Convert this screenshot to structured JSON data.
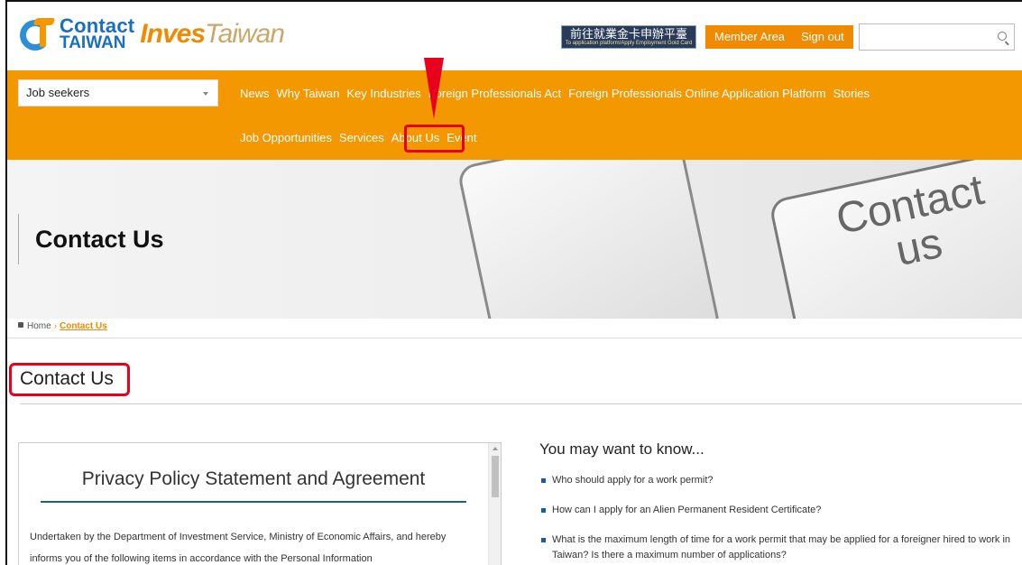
{
  "header": {
    "logo_line1": "Contact",
    "logo_line2": "TAIWAN",
    "logo_invest": "Inves",
    "logo_taiwan": "Taiwan",
    "gold_card_label": "前往就業金卡申辦平臺",
    "gold_card_sub": "To application platform/Apply Employment Gold Card",
    "member_area": "Member Area",
    "sign_out": "Sign out",
    "search_value": ""
  },
  "nav": {
    "audience_select": "Job seekers",
    "row1": [
      "News",
      "Why Taiwan",
      "Key Industries",
      "Foreign Professionals Act",
      "Foreign Professionals Online Application Platform",
      "Stories"
    ],
    "row2": [
      "Job Opportunities",
      "Services",
      "About Us",
      "Event"
    ]
  },
  "banner": {
    "title": "Contact Us",
    "image_text_1": "Contact",
    "image_text_2": "us"
  },
  "breadcrumb": {
    "home": "Home",
    "current": "Contact Us"
  },
  "page": {
    "title": "Contact Us"
  },
  "privacy": {
    "heading": "Privacy Policy Statement and Agreement",
    "body": "Undertaken by the Department of Investment Service, Ministry of Economic Affairs, and hereby informs you of the following items in accordance with the Personal Information"
  },
  "know": {
    "heading": "You may want to know...",
    "items": [
      "Who should apply for a work permit?",
      "How can I apply for an Alien Permanent Resident Certificate?",
      "What is the maximum length of time for a work permit that may be applied for a foreigner hired to work in Taiwan? Is there a maximum number of applications?"
    ]
  },
  "colors": {
    "brand_orange": "#f39800",
    "brand_blue": "#1a6fbf",
    "annotation_red": "#e8001c"
  }
}
